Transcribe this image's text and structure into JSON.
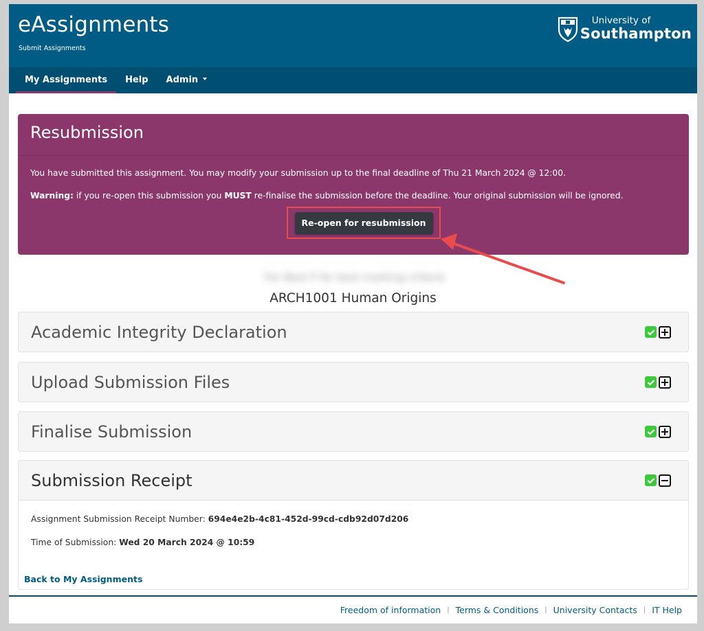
{
  "header": {
    "app_title": "eAssignments",
    "app_subtitle": "Submit Assignments",
    "logo": {
      "line1": "University of",
      "line2": "Southampton",
      "icon": "university-crest-icon"
    },
    "brand_color": "#005c85"
  },
  "nav": {
    "items": [
      {
        "label": "My Assignments",
        "active": true
      },
      {
        "label": "Help",
        "active": false
      },
      {
        "label": "Admin",
        "active": false,
        "dropdown": true
      }
    ]
  },
  "resubmission": {
    "title": "Resubmission",
    "message": "You have submitted this assignment. You may modify your submission up to the final deadline of Thu 21 March 2024 @ 12:00.",
    "warning_label": "Warning:",
    "warning_pre": " if you re-open this submission you ",
    "warning_must": "MUST",
    "warning_post": " re-finalise the submission before the deadline. Your original submission will be ignored.",
    "button_label": "Re-open for resubmission",
    "panel_color": "#8c376b",
    "annotation_color": "#e84c4c"
  },
  "assignment": {
    "blurred_title": "For Best P for best marking criteria",
    "course_title": "ARCH1001 Human Origins"
  },
  "sections": [
    {
      "title": "Academic Integrity Declaration",
      "complete": true,
      "expanded": false
    },
    {
      "title": "Upload Submission Files",
      "complete": true,
      "expanded": false
    },
    {
      "title": "Finalise Submission",
      "complete": true,
      "expanded": false
    },
    {
      "title": "Submission Receipt",
      "complete": true,
      "expanded": true
    }
  ],
  "receipt": {
    "number_label": "Assignment Submission Receipt Number:",
    "number_value": "694e4e2b-4c81-452d-99cd-cdb92d07d206",
    "time_label": "Time of Submission:",
    "time_value": "Wed 20 March 2024 @ 10:59"
  },
  "back_link": "Back to My Assignments",
  "footer": {
    "links": [
      "Freedom of information",
      "Terms & Conditions",
      "University Contacts",
      "IT Help"
    ],
    "separator": "|"
  }
}
